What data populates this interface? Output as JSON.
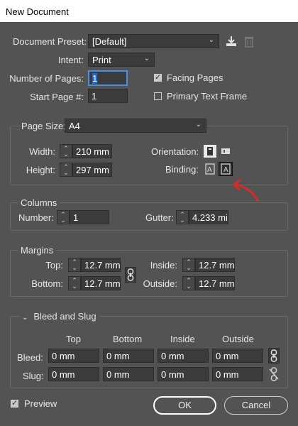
{
  "window": {
    "title": "New Document"
  },
  "document_preset": {
    "label": "Document Preset:",
    "value": "[Default]"
  },
  "intent": {
    "label": "Intent:",
    "value": "Print"
  },
  "pages": {
    "label": "Number of Pages:",
    "value": "1"
  },
  "start_page": {
    "label": "Start Page #:",
    "value": "1"
  },
  "facing_pages": {
    "label": "Facing Pages",
    "checked": true
  },
  "primary_text_frame": {
    "label": "Primary Text Frame",
    "checked": false
  },
  "page_size": {
    "label": "Page Size:",
    "value": "A4",
    "width_label": "Width:",
    "width": "210 mm",
    "height_label": "Height:",
    "height": "297 mm",
    "orientation_label": "Orientation:",
    "binding_label": "Binding:"
  },
  "columns": {
    "title": "Columns",
    "number_label": "Number:",
    "number": "1",
    "gutter_label": "Gutter:",
    "gutter": "4.233 mi"
  },
  "margins": {
    "title": "Margins",
    "top_label": "Top:",
    "top": "12.7 mm",
    "bottom_label": "Bottom:",
    "bottom": "12.7 mm",
    "inside_label": "Inside:",
    "inside": "12.7 mm",
    "outside_label": "Outside:",
    "outside": "12.7 mm"
  },
  "bleed_slug": {
    "title": "Bleed and Slug",
    "headers": [
      "Top",
      "Bottom",
      "Inside",
      "Outside"
    ],
    "bleed_label": "Bleed:",
    "bleed": [
      "0 mm",
      "0 mm",
      "0 mm",
      "0 mm"
    ],
    "slug_label": "Slug:",
    "slug": [
      "0 mm",
      "0 mm",
      "0 mm",
      "0 mm"
    ]
  },
  "preview": {
    "label": "Preview",
    "checked": true
  },
  "buttons": {
    "ok": "OK",
    "cancel": "Cancel"
  },
  "annotation": {
    "arrow_color": "#d42b2b"
  }
}
